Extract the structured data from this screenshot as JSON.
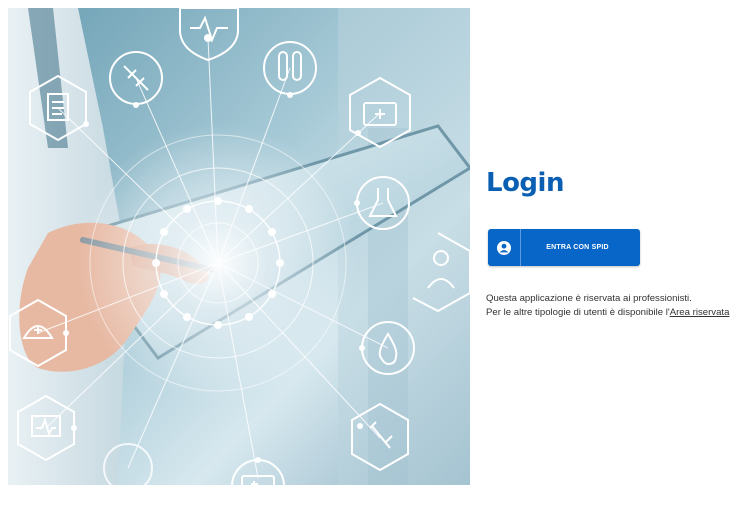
{
  "hero": {
    "image_alt": "Doctor holding a tablet with medical icons",
    "icons": [
      "heart-monitor-icon",
      "syringe-icon",
      "test-tubes-icon",
      "medical-kit-icon",
      "clipboard-icon",
      "flask-icon",
      "nurse-cap-icon",
      "doctor-icon",
      "blood-drop-icon",
      "ekg-monitor-icon",
      "vial-icon",
      "ambulance-icon",
      "tablet-icon"
    ]
  },
  "login": {
    "title": "Login",
    "spid_button_label": "ENTRA CON SPID",
    "spid_icon": "user-icon",
    "info_line1": "Questa applicazione è riservata ai professionisti.",
    "info_line2_prefix": "Per le altre tipologie di utenti è disponibile l'",
    "info_link_label": "Area riservata"
  },
  "colors": {
    "primary": "#0966c9",
    "title": "#0b5fb3",
    "text": "#333333",
    "background": "#ffffff"
  }
}
